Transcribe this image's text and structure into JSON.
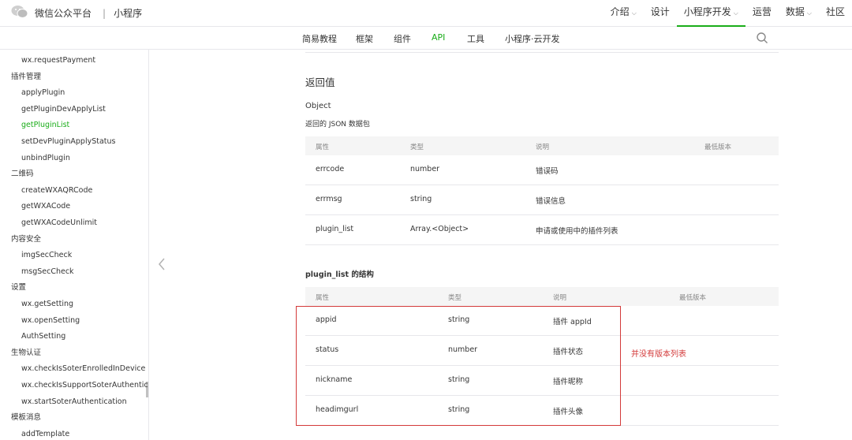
{
  "header": {
    "brand": "微信公众平台",
    "section": "小程序",
    "nav": [
      {
        "label": "介绍",
        "chevron": true
      },
      {
        "label": "设计",
        "chevron": false
      },
      {
        "label": "小程序开发",
        "chevron": true
      },
      {
        "label": "运营",
        "chevron": false
      },
      {
        "label": "数据",
        "chevron": true
      },
      {
        "label": "社区",
        "chevron": false
      }
    ]
  },
  "subnav": {
    "tabs": [
      "简易教程",
      "框架",
      "组件",
      "API",
      "工具",
      "小程序·云开发"
    ],
    "active": "API"
  },
  "sidebar": {
    "items": [
      {
        "label": "wx.requestPayment",
        "type": "leaf"
      },
      {
        "label": "插件管理",
        "type": "group"
      },
      {
        "label": "applyPlugin",
        "type": "leaf"
      },
      {
        "label": "getPluginDevApplyList",
        "type": "leaf"
      },
      {
        "label": "getPluginList",
        "type": "leaf",
        "active": true
      },
      {
        "label": "setDevPluginApplyStatus",
        "type": "leaf"
      },
      {
        "label": "unbindPlugin",
        "type": "leaf"
      },
      {
        "label": "二维码",
        "type": "group"
      },
      {
        "label": "createWXAQRCode",
        "type": "leaf"
      },
      {
        "label": "getWXACode",
        "type": "leaf"
      },
      {
        "label": "getWXACodeUnlimit",
        "type": "leaf"
      },
      {
        "label": "内容安全",
        "type": "group"
      },
      {
        "label": "imgSecCheck",
        "type": "leaf"
      },
      {
        "label": "msgSecCheck",
        "type": "leaf"
      },
      {
        "label": "设置",
        "type": "group"
      },
      {
        "label": "wx.getSetting",
        "type": "leaf"
      },
      {
        "label": "wx.openSetting",
        "type": "leaf"
      },
      {
        "label": "AuthSetting",
        "type": "leaf"
      },
      {
        "label": "生物认证",
        "type": "group"
      },
      {
        "label": "wx.checkIsSoterEnrolledInDevice",
        "type": "leaf"
      },
      {
        "label": "wx.checkIsSupportSoterAuthenticatic",
        "type": "leaf"
      },
      {
        "label": "wx.startSoterAuthentication",
        "type": "leaf"
      },
      {
        "label": "模板消息",
        "type": "group"
      },
      {
        "label": "addTemplate",
        "type": "leaf"
      }
    ]
  },
  "content": {
    "return_heading": "返回值",
    "return_type": "Object",
    "return_desc": "返回的 JSON 数据包",
    "table1": {
      "headers": [
        "属性",
        "类型",
        "说明",
        "最低版本"
      ],
      "rows": [
        [
          "errcode",
          "number",
          "错误码",
          ""
        ],
        [
          "errmsg",
          "string",
          "错误信息",
          ""
        ],
        [
          "plugin_list",
          "Array.<Object>",
          "申请或使用中的插件列表",
          ""
        ]
      ]
    },
    "struct_heading": "plugin_list 的结构",
    "table2": {
      "headers": [
        "属性",
        "类型",
        "说明",
        "最低版本"
      ],
      "rows": [
        [
          "appid",
          "string",
          "插件 appId",
          ""
        ],
        [
          "status",
          "number",
          "插件状态",
          ""
        ],
        [
          "nickname",
          "string",
          "插件昵称",
          ""
        ],
        [
          "headimgurl",
          "string",
          "插件头像",
          ""
        ]
      ]
    },
    "annotation": "并没有版本列表"
  },
  "colors": {
    "accent": "#1aad19",
    "annotation": "#d33a3a",
    "border": "#e7e7eb"
  }
}
